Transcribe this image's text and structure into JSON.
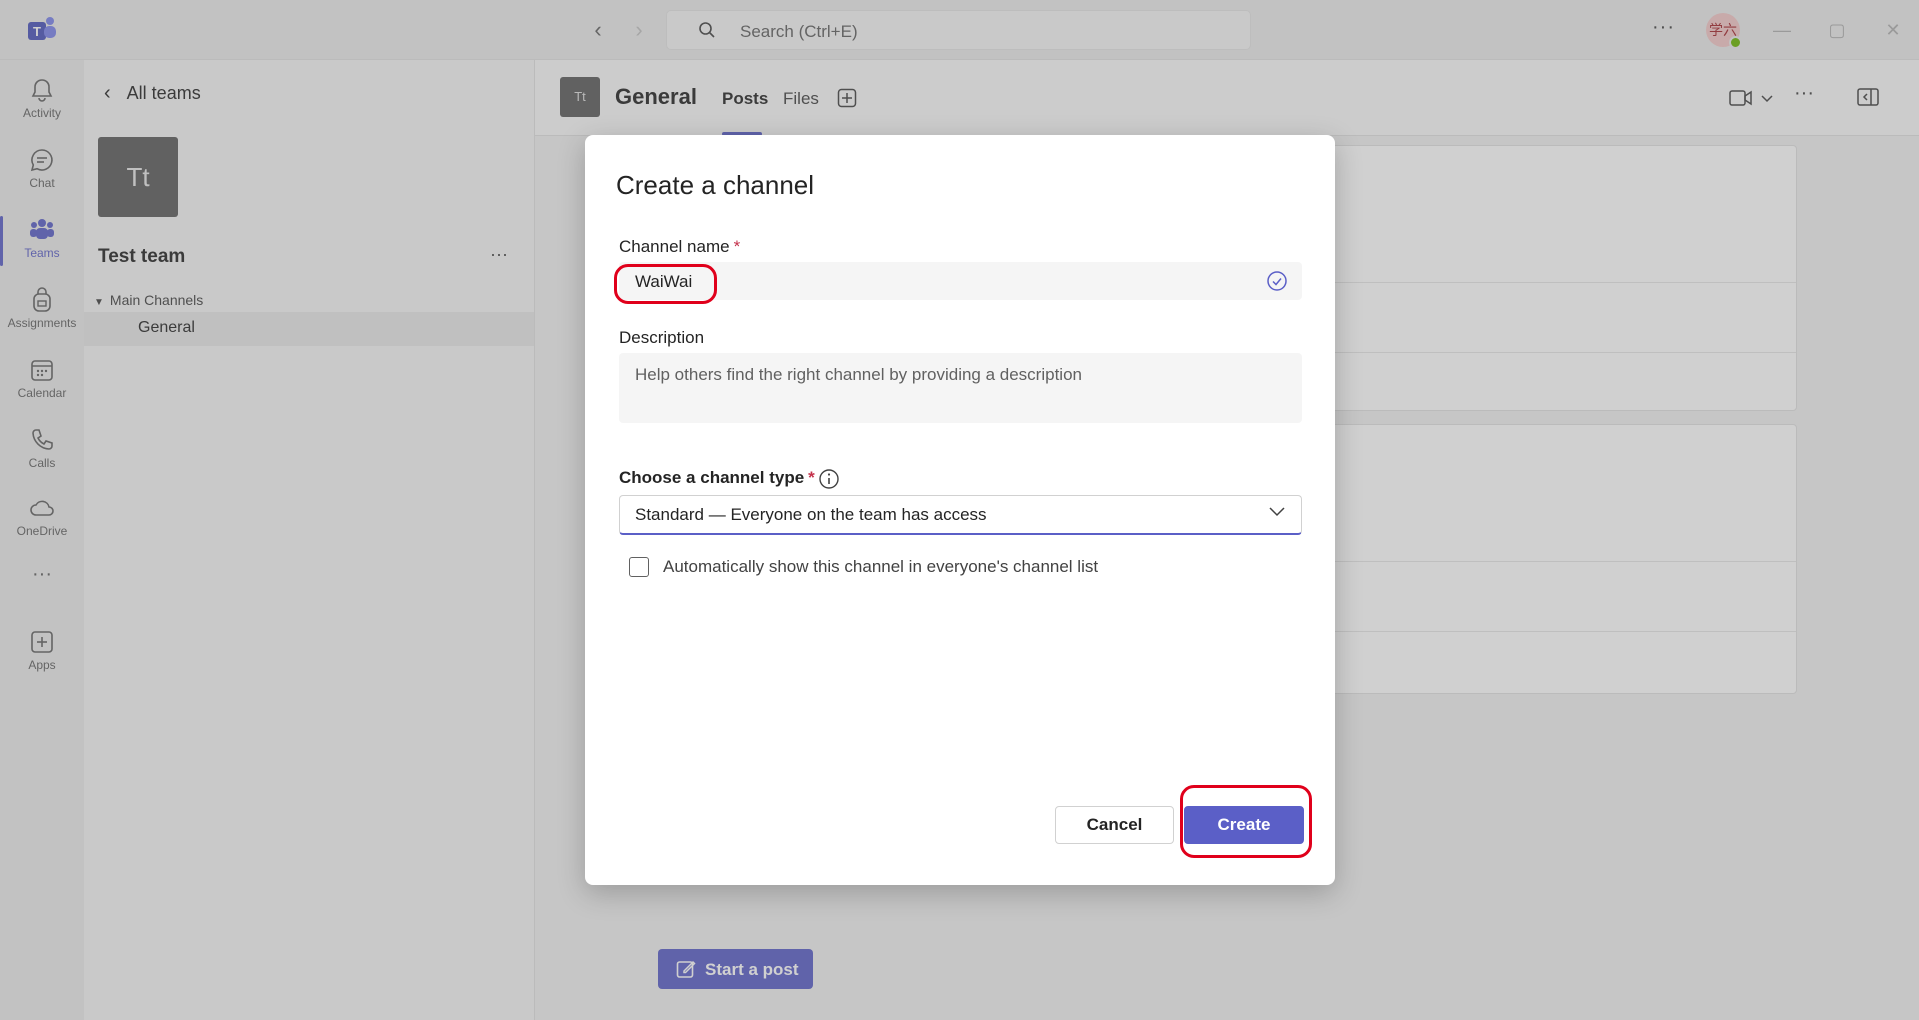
{
  "titlebar": {
    "search_placeholder": "Search (Ctrl+E)",
    "avatar_initials": "学六",
    "more": "···"
  },
  "rail": {
    "items": [
      {
        "label": "Activity",
        "icon": "bell-icon"
      },
      {
        "label": "Chat",
        "icon": "chat-icon"
      },
      {
        "label": "Teams",
        "icon": "teams-icon",
        "active": true
      },
      {
        "label": "Assignments",
        "icon": "backpack-icon"
      },
      {
        "label": "Calendar",
        "icon": "calendar-icon"
      },
      {
        "label": "Calls",
        "icon": "phone-icon"
      },
      {
        "label": "OneDrive",
        "icon": "cloud-icon"
      },
      {
        "label": "Apps",
        "icon": "add-square-icon"
      }
    ],
    "more": "···"
  },
  "leftpanel": {
    "back_label": "All teams",
    "team_initials": "Tt",
    "team_name": "Test team",
    "more": "···",
    "section_label": "Main Channels",
    "channels": [
      "General"
    ]
  },
  "channel": {
    "initials": "Tt",
    "title": "General",
    "tabs": [
      "Posts",
      "Files"
    ],
    "start_post": "Start a post"
  },
  "dialog": {
    "title": "Create a channel",
    "name_label": "Channel name",
    "required_marker": "*",
    "name_value": "WaiWai",
    "description_label": "Description",
    "description_placeholder": "Help others find the right channel by providing a description",
    "type_label": "Choose a channel type",
    "type_value": "Standard — Everyone on the team has access",
    "auto_show_label": "Automatically show this channel in everyone's channel list",
    "auto_show_checked": false,
    "cancel": "Cancel",
    "create": "Create"
  },
  "colors": {
    "accent": "#5b5fc7",
    "highlight": "#e0001b"
  }
}
